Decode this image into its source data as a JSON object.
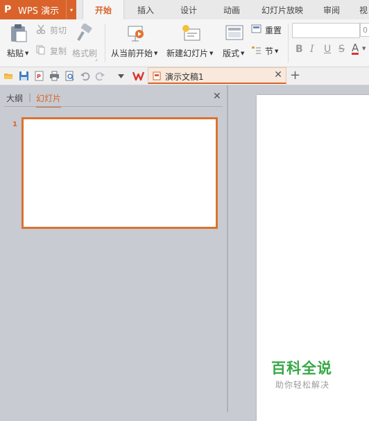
{
  "app": {
    "logo": "P",
    "name": "WPS 演示",
    "menu_caret": "▾"
  },
  "tabs": [
    {
      "label": "开始",
      "active": true
    },
    {
      "label": "插入",
      "active": false
    },
    {
      "label": "设计",
      "active": false
    },
    {
      "label": "动画",
      "active": false
    },
    {
      "label": "幻灯片放映",
      "active": false
    },
    {
      "label": "审阅",
      "active": false
    },
    {
      "label": "视",
      "active": false
    }
  ],
  "ribbon": {
    "paste": "粘贴",
    "cut": "剪切",
    "copy": "复制",
    "format_painter": "格式刷",
    "from_current": "从当前开始",
    "new_slide": "新建幻灯片",
    "layout": "版式",
    "reset": "重置",
    "section": "节",
    "font_size_value": "0",
    "bold": "B",
    "italic": "I",
    "underline": "U",
    "strikethrough": "S",
    "font_color": "A"
  },
  "quick_access": {
    "icons": [
      "open-folder-icon",
      "save-icon",
      "export-pdf-icon",
      "print-icon",
      "print-preview-icon",
      "undo-icon",
      "redo-icon",
      "customize-dropdown-icon"
    ],
    "accent": "#d9632b"
  },
  "document_tab": {
    "title": "演示文稿1",
    "close": "✕"
  },
  "new_tab": "+",
  "left_pane": {
    "outline_tab": "大纲",
    "separator": "|",
    "slides_tab": "幻灯片",
    "close": "✕",
    "slide_number": "1"
  },
  "watermark": {
    "title": "百科全说",
    "subtitle": "助你轻松解决"
  },
  "colors": {
    "accent": "#d9632b",
    "workspace": "#c8cbd1",
    "watermark_green": "#35a845"
  }
}
